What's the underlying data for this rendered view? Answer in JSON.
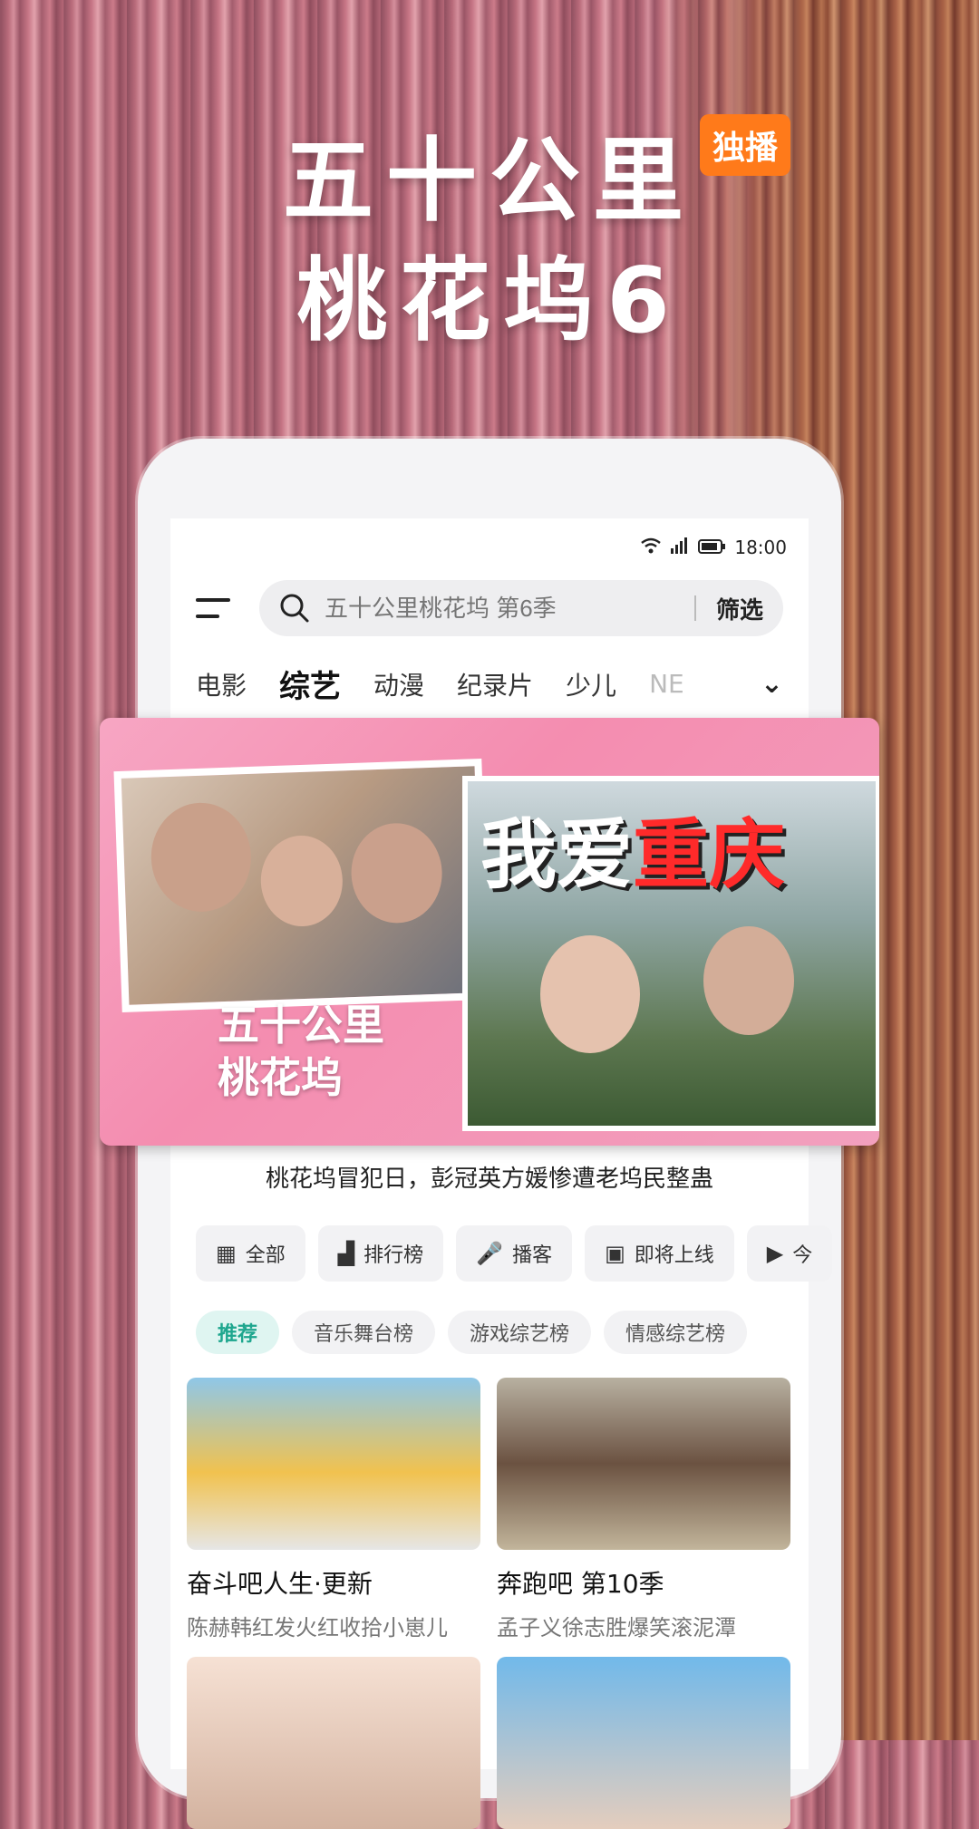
{
  "hero": {
    "line1": "五十公里",
    "line2": "桃花坞6",
    "badge": "独播"
  },
  "status_bar": {
    "time": "18:00"
  },
  "search": {
    "placeholder": "五十公里桃花坞 第6季",
    "filter_label": "筛选"
  },
  "tabs": [
    {
      "label": "电影"
    },
    {
      "label": "综艺"
    },
    {
      "label": "动漫"
    },
    {
      "label": "纪录片"
    },
    {
      "label": "少儿"
    },
    {
      "label": "NE"
    }
  ],
  "banner": {
    "headline_part1": "我爱",
    "headline_part2": "重庆",
    "logo_line1": "五十公里",
    "logo_line2": "桃花坞"
  },
  "caption": "桃花坞冒犯日，彭冠英方媛惨遭老坞民整蛊",
  "quick_links": [
    {
      "label": "全部",
      "icon": "grid-icon"
    },
    {
      "label": "排行榜",
      "icon": "podium-icon"
    },
    {
      "label": "播客",
      "icon": "microphone-icon"
    },
    {
      "label": "即将上线",
      "icon": "calendar-icon"
    },
    {
      "label": "今",
      "icon": "tv-icon"
    }
  ],
  "chips": [
    {
      "label": "推荐"
    },
    {
      "label": "音乐舞台榜"
    },
    {
      "label": "游戏综艺榜"
    },
    {
      "label": "情感综艺榜"
    }
  ],
  "cards": [
    {
      "title": "奋斗吧人生·更新",
      "subtitle": "陈赫韩红发火红收拾小崽儿"
    },
    {
      "title": "奔跑吧 第10季",
      "subtitle": "孟子义徐志胜爆笑滚泥潭"
    }
  ]
}
